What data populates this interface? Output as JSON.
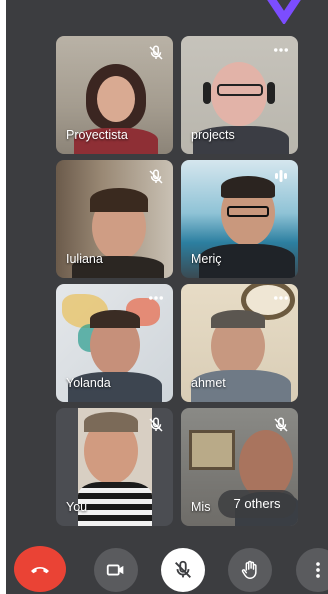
{
  "participants": [
    {
      "name": "Proyectista",
      "state": "muted"
    },
    {
      "name": "projects",
      "state": "more"
    },
    {
      "name": "Iuliana",
      "state": "muted"
    },
    {
      "name": "Meriç",
      "state": "speaking"
    },
    {
      "name": "Yolanda",
      "state": "more"
    },
    {
      "name": "ahmet",
      "state": "more"
    },
    {
      "name": "You",
      "state": "muted"
    },
    {
      "name": "Mis",
      "state": "muted"
    }
  ],
  "others_label": "7 others",
  "controls": [
    {
      "icon": "end-call-icon"
    },
    {
      "icon": "camera-icon"
    },
    {
      "icon": "mic-off-icon"
    },
    {
      "icon": "raise-hand-icon"
    },
    {
      "icon": "more-vert-icon"
    }
  ],
  "colors": {
    "background": "#3c3d40",
    "end_call": "#ea4335",
    "accent": "#7c4dff",
    "control": "#5a5b5e"
  }
}
